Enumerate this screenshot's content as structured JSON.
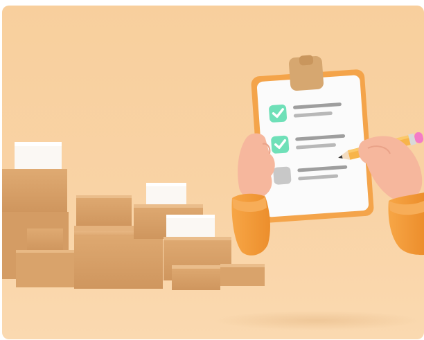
{
  "scene": {
    "subject": "packages-and-checklist-illustration",
    "colors": {
      "background": "#f9d3a5",
      "box": "#d6a06a",
      "box_shadow_side": "#c38850",
      "white_box": "#fbf8f4",
      "clipboard_frame": "#f4a44a",
      "paper": "#fbfbfb",
      "check_green": "#6fe0b8",
      "hand": "#f6b79d",
      "sleeve": "#f39a3a",
      "pencil": "#f7b44a",
      "eraser": "#f47bc7"
    },
    "checklist": {
      "items": [
        {
          "state": "checked"
        },
        {
          "state": "checked"
        },
        {
          "state": "unchecked"
        }
      ]
    }
  }
}
